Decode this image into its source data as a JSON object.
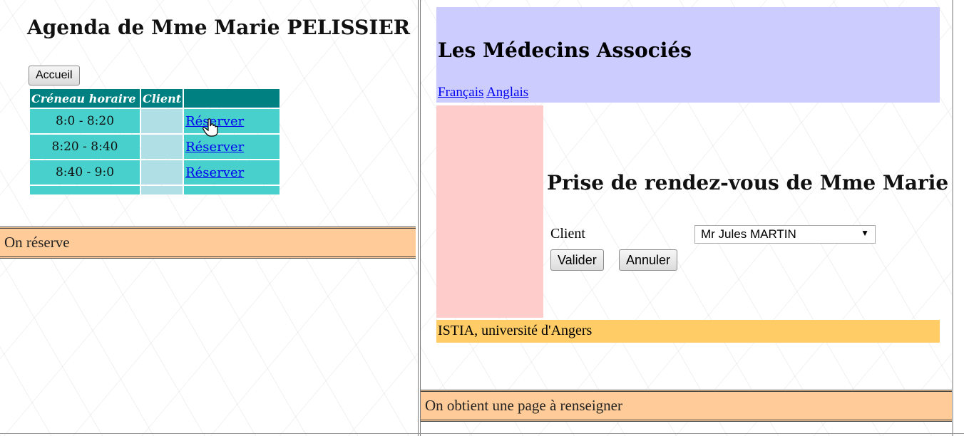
{
  "left": {
    "title": "Agenda de Mme Marie PELISSIER",
    "home_button": "Accueil",
    "table": {
      "headers": [
        "Créneau horaire",
        "Client",
        ""
      ],
      "rows": [
        {
          "slot": "8:0 - 8:20",
          "client": "",
          "action": "Réserver"
        },
        {
          "slot": "8:20 - 8:40",
          "client": "",
          "action": "Réserver"
        },
        {
          "slot": "8:40 - 9:0",
          "client": "",
          "action": "Réserver"
        },
        {
          "slot": "",
          "client": "",
          "action": ""
        }
      ]
    },
    "caption": "On réserve"
  },
  "right": {
    "site_title": "Les Médecins Associés",
    "languages": [
      "Français",
      "Anglais"
    ],
    "form_title": "Prise de rendez-vous de Mme Marie",
    "client_label": "Client",
    "client_selected": "Mr Jules MARTIN",
    "validate_button": "Valider",
    "cancel_button": "Annuler",
    "footer": "ISTIA, université d'Angers",
    "caption": "On obtient une page à renseigner"
  },
  "colors": {
    "header_bg": "#ccccff",
    "sidebar_bg": "#ffcccc",
    "footer_bg": "#ffcc66",
    "caption_bg": "#ffcc99",
    "table_header_bg": "#008080",
    "slot_bg": "#48d1cc",
    "client_bg": "#b0e0e6"
  }
}
